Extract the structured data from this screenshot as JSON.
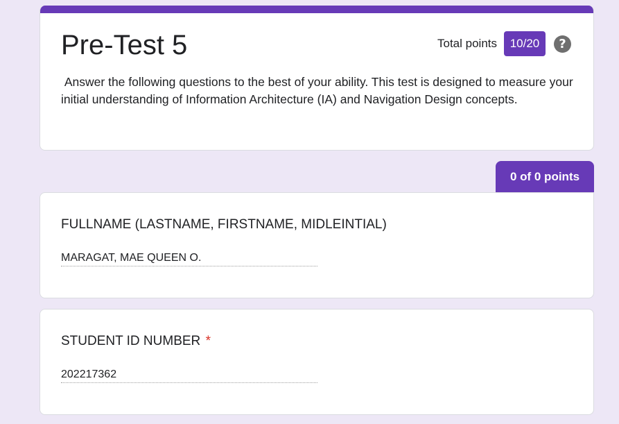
{
  "form": {
    "title": "Pre-Test 5",
    "total_points_label": "Total points",
    "score": "10/20",
    "help_symbol": "?",
    "description": " Answer the following questions to the best of your ability. This test is designed to measure your initial understanding of Information Architecture (IA) and Navigation Design concepts."
  },
  "section": {
    "points_label": "0 of 0 points"
  },
  "questions": [
    {
      "title": "FULLNAME (LASTNAME, FIRSTNAME, MIDLEINTIAL)",
      "required": false,
      "answer": "MARAGAT, MAE QUEEN O."
    },
    {
      "title": "STUDENT ID NUMBER",
      "required": true,
      "required_mark": "*",
      "answer": "202217362"
    }
  ],
  "colors": {
    "accent": "#673ab7",
    "background": "#ede7f6",
    "required": "#d93025"
  }
}
